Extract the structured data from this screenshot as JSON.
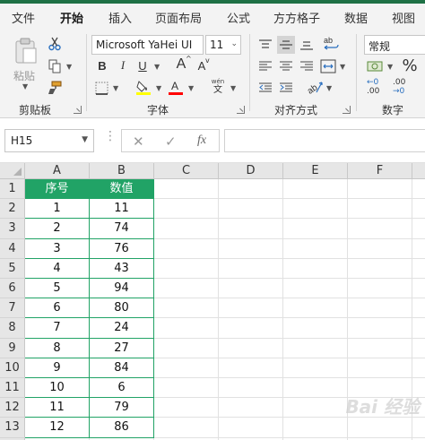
{
  "menu": {
    "tabs": [
      "文件",
      "开始",
      "插入",
      "页面布局",
      "公式",
      "方方格子",
      "数据",
      "视图"
    ],
    "active_index": 1
  },
  "ribbon": {
    "clipboard": {
      "paste_label": "粘贴",
      "group_label": "剪贴板"
    },
    "font": {
      "font_name": "Microsoft YaHei UI",
      "font_size": "11",
      "bold": "B",
      "italic": "I",
      "underline": "U",
      "grow": "A",
      "shrink": "A",
      "phonetic_top": "wén",
      "phonetic_bottom": "文",
      "group_label": "字体",
      "fill_color": "#ffff00",
      "font_color": "#ff0000"
    },
    "alignment": {
      "group_label": "对齐方式",
      "wrap_icon": "ab"
    },
    "number": {
      "format": "常规",
      "percent": "%",
      "group_label": "数字",
      "inc_top": "←0",
      "inc_bottom": ".00",
      "dec_top": ".00",
      "dec_bottom": "→0"
    }
  },
  "formula_bar": {
    "name_box": "H15",
    "fx_label": "fx",
    "formula": ""
  },
  "sheet": {
    "columns": [
      "A",
      "B",
      "C",
      "D",
      "E",
      "F"
    ],
    "rows": [
      "1",
      "2",
      "3",
      "4",
      "5",
      "6",
      "7",
      "8",
      "9",
      "10",
      "11",
      "12",
      "13"
    ],
    "header": [
      "序号",
      "数值"
    ],
    "data": [
      [
        "1",
        "11"
      ],
      [
        "2",
        "74"
      ],
      [
        "3",
        "76"
      ],
      [
        "4",
        "43"
      ],
      [
        "5",
        "94"
      ],
      [
        "6",
        "80"
      ],
      [
        "7",
        "24"
      ],
      [
        "8",
        "27"
      ],
      [
        "9",
        "84"
      ],
      [
        "10",
        "6"
      ],
      [
        "11",
        "79"
      ],
      [
        "12",
        "86"
      ]
    ],
    "accent_color": "#21a366"
  },
  "watermark": "Bai 经验"
}
